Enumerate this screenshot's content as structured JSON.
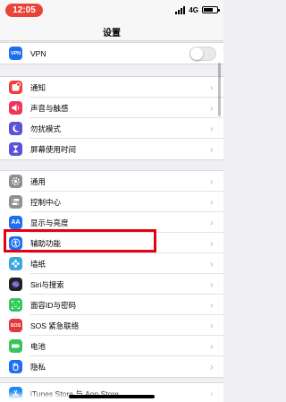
{
  "status": {
    "time": "12:05",
    "network": "4G"
  },
  "nav": {
    "title": "设置"
  },
  "groups": [
    {
      "rows": [
        {
          "name": "vpn",
          "label": "VPN",
          "icon": "vpn-icon",
          "icon_text": "VPN",
          "color": "#1d6ff2",
          "accessory": "toggle",
          "toggle_on": false
        }
      ]
    },
    {
      "rows": [
        {
          "name": "notifications",
          "label": "通知",
          "icon": "notifications-icon",
          "color": "#f0403d"
        },
        {
          "name": "sounds",
          "label": "声音与触感",
          "icon": "speaker-icon",
          "color": "#f0355b"
        },
        {
          "name": "do-not-disturb",
          "label": "勿扰模式",
          "icon": "moon-icon",
          "color": "#5b53d6"
        },
        {
          "name": "screen-time",
          "label": "屏幕使用时间",
          "icon": "hourglass-icon",
          "color": "#5b53d6"
        }
      ]
    },
    {
      "rows": [
        {
          "name": "general",
          "label": "通用",
          "icon": "gear-icon",
          "color": "#8e8e93"
        },
        {
          "name": "control-center",
          "label": "控制中心",
          "icon": "toggles-icon",
          "color": "#8e8e93"
        },
        {
          "name": "display",
          "label": "显示与亮度",
          "icon": "text-size-icon",
          "icon_text": "AA",
          "color": "#1d6ff2"
        },
        {
          "name": "accessibility",
          "label": "辅助功能",
          "icon": "accessibility-icon",
          "color": "#1d6ff2"
        },
        {
          "name": "wallpaper",
          "label": "墙纸",
          "icon": "flower-icon",
          "color": "#37a9e0"
        },
        {
          "name": "siri",
          "label": "Siri与搜索",
          "icon": "siri-icon",
          "color": "#222222"
        },
        {
          "name": "face-id",
          "label": "面容ID与密码",
          "icon": "face-id-icon",
          "color": "#34c759"
        },
        {
          "name": "sos",
          "label": "SOS 紧急联络",
          "icon": "sos-icon",
          "icon_text": "SOS",
          "color": "#e5383b"
        },
        {
          "name": "battery",
          "label": "电池",
          "icon": "battery-icon",
          "color": "#34c759"
        },
        {
          "name": "privacy",
          "label": "隐私",
          "icon": "hand-icon",
          "color": "#1d6ff2"
        }
      ]
    },
    {
      "rows": [
        {
          "name": "itunes-store",
          "label": "iTunes Store 与 App Store",
          "icon": "app-store-icon",
          "color": "#1d8cf2"
        }
      ]
    }
  ]
}
